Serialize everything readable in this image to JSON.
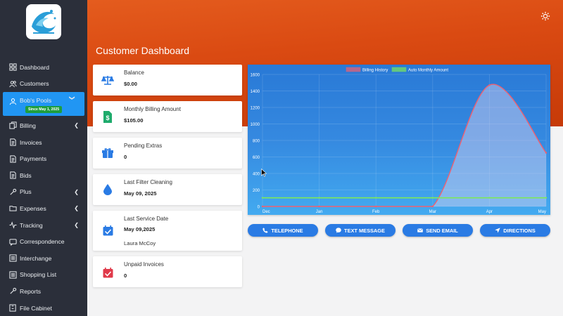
{
  "sidebar": {
    "items": [
      {
        "label": "Dashboard",
        "icon": "grid-icon"
      },
      {
        "label": "Customers",
        "icon": "users-icon"
      },
      {
        "label": "Bob's Pools",
        "icon": "user-icon",
        "badge": "Since May 1, 2025"
      },
      {
        "label": "Billing",
        "icon": "files-icon"
      },
      {
        "label": "Invoices",
        "icon": "document-icon"
      },
      {
        "label": "Payments",
        "icon": "document-icon"
      },
      {
        "label": "Bids",
        "icon": "document-icon"
      },
      {
        "label": "Plus",
        "icon": "wrench-icon"
      },
      {
        "label": "Expenses",
        "icon": "folder-icon"
      },
      {
        "label": "Tracking",
        "icon": "pulse-icon"
      },
      {
        "label": "Correspondence",
        "icon": "chat-icon"
      },
      {
        "label": "Interchange",
        "icon": "list-icon"
      },
      {
        "label": "Shopping List",
        "icon": "list-icon"
      },
      {
        "label": "Reports",
        "icon": "wrench-icon"
      },
      {
        "label": "File Cabinet",
        "icon": "cabinet-icon"
      }
    ]
  },
  "header": {
    "title": "Customer Dashboard"
  },
  "cards": {
    "balance": {
      "label": "Balance",
      "value": "$0.00"
    },
    "monthly": {
      "label": "Monthly Billing Amount",
      "value": "$105.00"
    },
    "extras": {
      "label": "Pending Extras",
      "value": "0"
    },
    "filter": {
      "label": "Last Filter Cleaning",
      "value": "May 09, 2025"
    },
    "service": {
      "label": "Last Service Date",
      "value": "May 09,2025",
      "tech": "Laura McCoy"
    },
    "unpaid": {
      "label": "Unpaid Invoices",
      "value": "0"
    }
  },
  "buttons": {
    "telephone": "TELEPHONE",
    "text": "TEXT MESSAGE",
    "email": "SEND EMAIL",
    "directions": "DIRECTIONS"
  },
  "colors": {
    "header": "#da4a12",
    "sidebar": "#2b2f3a",
    "accent": "#2196f3",
    "billing_series": "#f06070",
    "auto_series": "#7de85a"
  },
  "chart_data": {
    "type": "line",
    "categories": [
      "Dec",
      "Jan",
      "Feb",
      "Mar",
      "Apr",
      "May"
    ],
    "series": [
      {
        "name": "Billing History",
        "values": [
          0,
          0,
          0,
          0,
          1470,
          650
        ],
        "color": "#f06070"
      },
      {
        "name": "Auto Monthly Amount",
        "values": [
          105,
          105,
          105,
          105,
          105,
          105
        ],
        "color": "#7de85a"
      }
    ],
    "yticks": [
      0,
      200,
      400,
      600,
      800,
      1000,
      1200,
      1400,
      1600
    ],
    "ylim": [
      0,
      1600
    ],
    "grid": true,
    "legend": "top-center"
  }
}
